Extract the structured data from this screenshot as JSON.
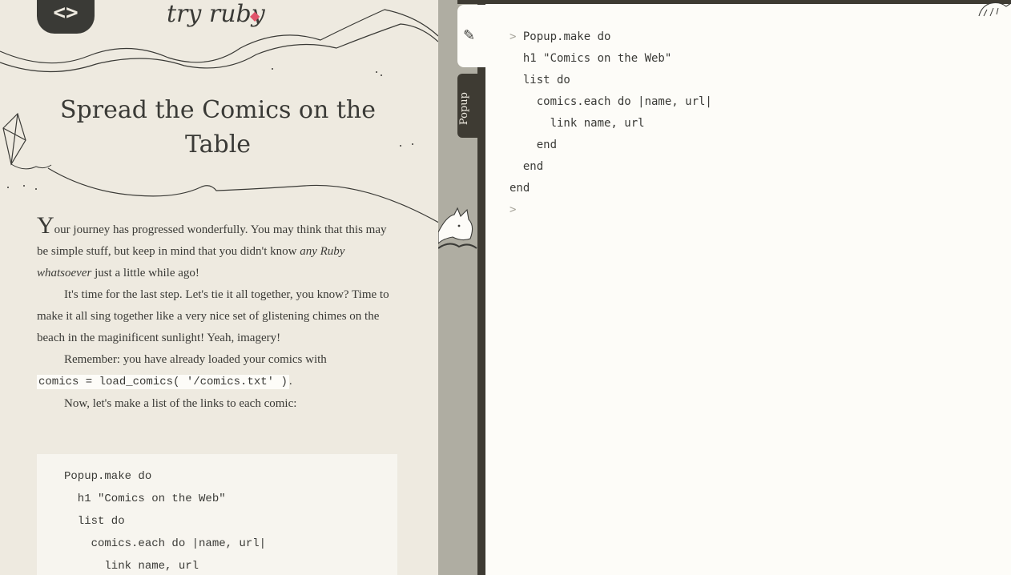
{
  "header": {
    "logo_text": "try ruby",
    "nav_icon": "code-brackets-icon"
  },
  "lesson": {
    "title": "Spread the Comics on the Table",
    "p1_dropcap": "Y",
    "p1_text_a": "our journey has progressed wonderfully. You may think that this may be simple stuff, but keep in mind that you didn't know ",
    "p1_emphasis": "any Ruby whatsoever",
    "p1_text_b": " just a little while ago!",
    "p2": "It's time for the last step. Let's tie it all together, you know? Time to make it all sing together like a very nice set of glistening chimes on the beach in the maginificent sunlight! Yeah, imagery!",
    "p3_text": "Remember: you have already loaded your comics with",
    "p3_code": "comics = load_comics( '/comics.txt' )",
    "p3_end": ".",
    "p4": "Now, let's make a list of the links to each comic:",
    "code_block": "Popup.make do\n  h1 \"Comics on the Web\"\n  list do\n    comics.each do |name, url|\n      link name, url"
  },
  "tabs": {
    "edit_icon": "edit-icon",
    "popup_label": "Popup"
  },
  "editor": {
    "prompt": ">",
    "line1": "Popup.make do",
    "lines_rest": "  h1 \"Comics on the Web\"\n  list do\n    comics.each do |name, url|\n      link name, url\n    end\n  end\nend",
    "empty_prompt": ">"
  }
}
